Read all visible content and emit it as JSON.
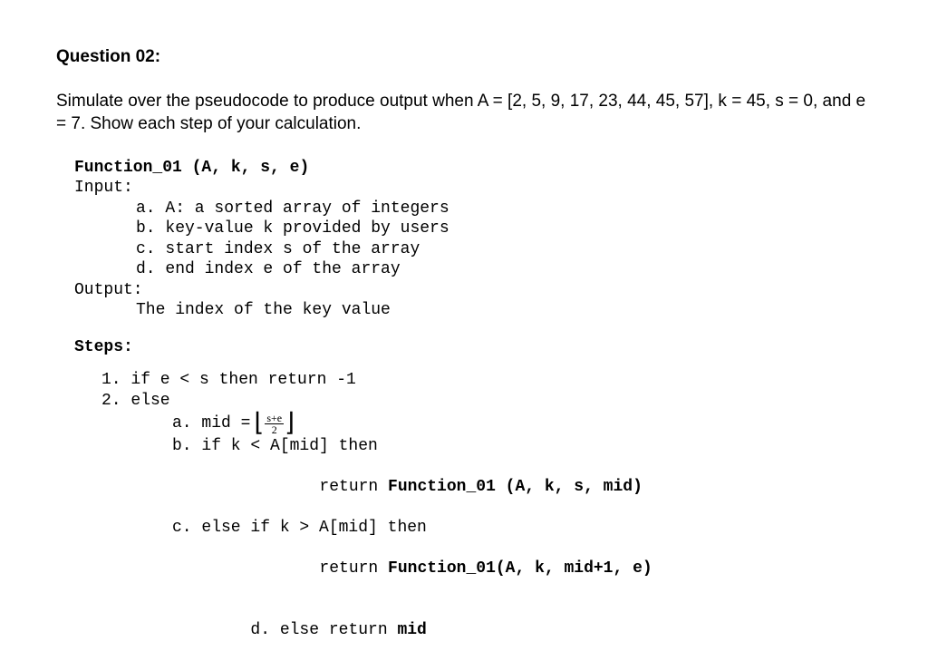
{
  "title": "Question 02:",
  "instruction": "Simulate over the pseudocode to produce output when A = [2, 5, 9, 17, 23, 44, 45, 57], k = 45, s = 0, and e = 7. Show each step of your calculation.",
  "pseudo": {
    "func_sig": "Function_01 (A, k, s, e)",
    "input_label": "Input:",
    "input_a": "a. A: a sorted array of integers",
    "input_b": "b. key-value k provided by users",
    "input_c": "c. start index s of the array",
    "input_d": "d. end index e of the array",
    "output_label": "Output:",
    "output_text": "The index of the key value",
    "steps_label": "Steps:",
    "step1": "1. if e < s then return -1",
    "step2": "2. else",
    "step_a_prefix": "a. mid = ",
    "frac_num": "s+e",
    "frac_den": "2",
    "step_b": "b. if k < A[mid] then",
    "step_b_ret_plain": "return ",
    "step_b_ret_bold": "Function_01 (A, k, s, mid)",
    "step_c": "c. else if k > A[mid] then",
    "step_c_ret_plain": "return ",
    "step_c_ret_bold": "Function_01(A, k, mid+1, e)",
    "step_d_prefix": "d. else return ",
    "step_d_bold": "mid"
  }
}
